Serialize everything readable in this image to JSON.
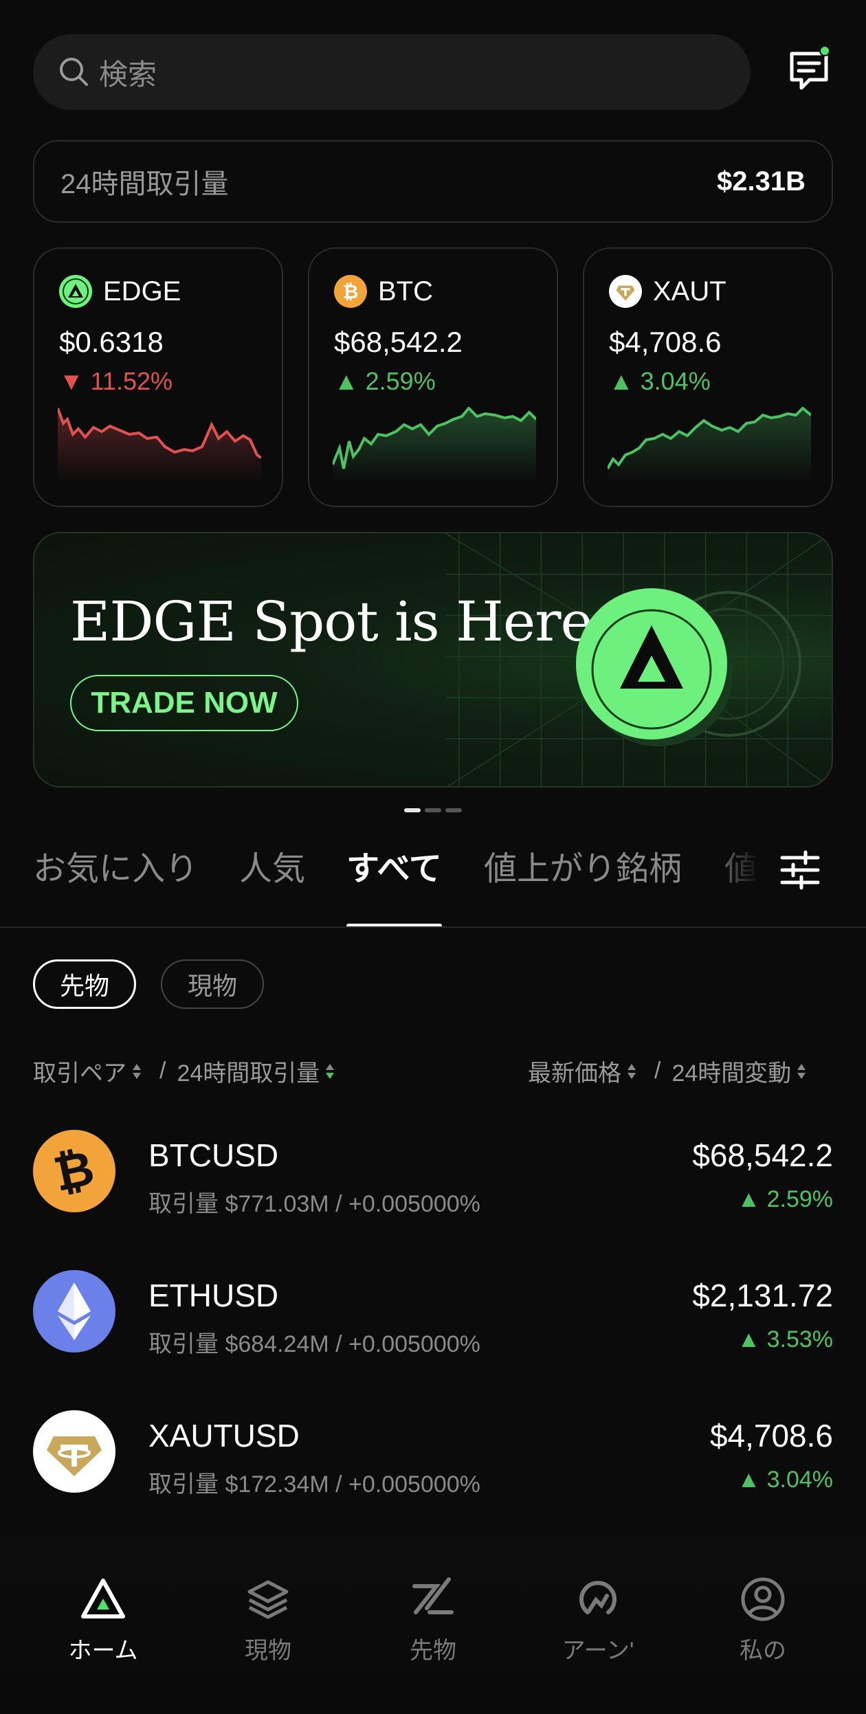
{
  "search": {
    "placeholder": "検索"
  },
  "volume": {
    "label": "24時間取引量",
    "value": "$2.31B"
  },
  "tickers": [
    {
      "symbol": "EDGE",
      "price": "$0.6318",
      "change": "▼ 11.52%",
      "direction": "down",
      "icon": "edge-icon"
    },
    {
      "symbol": "BTC",
      "price": "$68,542.2",
      "change": "▲ 2.59%",
      "direction": "up",
      "icon": "bitcoin-icon"
    },
    {
      "symbol": "XAUT",
      "price": "$4,708.6",
      "change": "▲ 3.04%",
      "direction": "up",
      "icon": "tether-gold-icon"
    }
  ],
  "banner": {
    "title": "EDGE Spot is Here",
    "button": "TRADE NOW"
  },
  "pager": {
    "count": 3,
    "active": 0
  },
  "tabs": [
    {
      "label": "お気に入り",
      "active": false
    },
    {
      "label": "人気",
      "active": false
    },
    {
      "label": "すべて",
      "active": true
    },
    {
      "label": "値上がり銘柄",
      "active": false
    },
    {
      "label": "値下",
      "active": false
    }
  ],
  "chips": [
    {
      "label": "先物",
      "active": true
    },
    {
      "label": "現物",
      "active": false
    }
  ],
  "columns": {
    "pair": "取引ペア",
    "volume": "24時間取引量",
    "price": "最新価格",
    "change": "24時間変動",
    "separator": "/"
  },
  "rows": [
    {
      "symbol": "BTCUSD",
      "sub": "取引量 $771.03M / +0.005000%",
      "price": "$68,542.2",
      "change": "▲ 2.59%",
      "icon": "bitcoin-icon"
    },
    {
      "symbol": "ETHUSD",
      "sub": "取引量 $684.24M / +0.005000%",
      "price": "$2,131.72",
      "change": "▲ 3.53%",
      "icon": "ethereum-icon"
    },
    {
      "symbol": "XAUTUSD",
      "sub": "取引量 $172.34M / +0.005000%",
      "price": "$4,708.6",
      "change": "▲ 3.04%",
      "icon": "tether-gold-icon"
    }
  ],
  "nav": [
    {
      "label": "ホーム",
      "active": true,
      "icon": "home-icon"
    },
    {
      "label": "現物",
      "active": false,
      "icon": "spot-icon"
    },
    {
      "label": "先物",
      "active": false,
      "icon": "futures-icon"
    },
    {
      "label": "アーン'",
      "active": false,
      "icon": "earn-icon"
    },
    {
      "label": "私の",
      "active": false,
      "icon": "profile-icon"
    }
  ],
  "colors": {
    "accent_green": "#7bf58a",
    "up": "#4cc263",
    "down": "#e0524f",
    "background": "#0b0b0b",
    "btc": "#f2a43a",
    "eth": "#6b80e8"
  }
}
